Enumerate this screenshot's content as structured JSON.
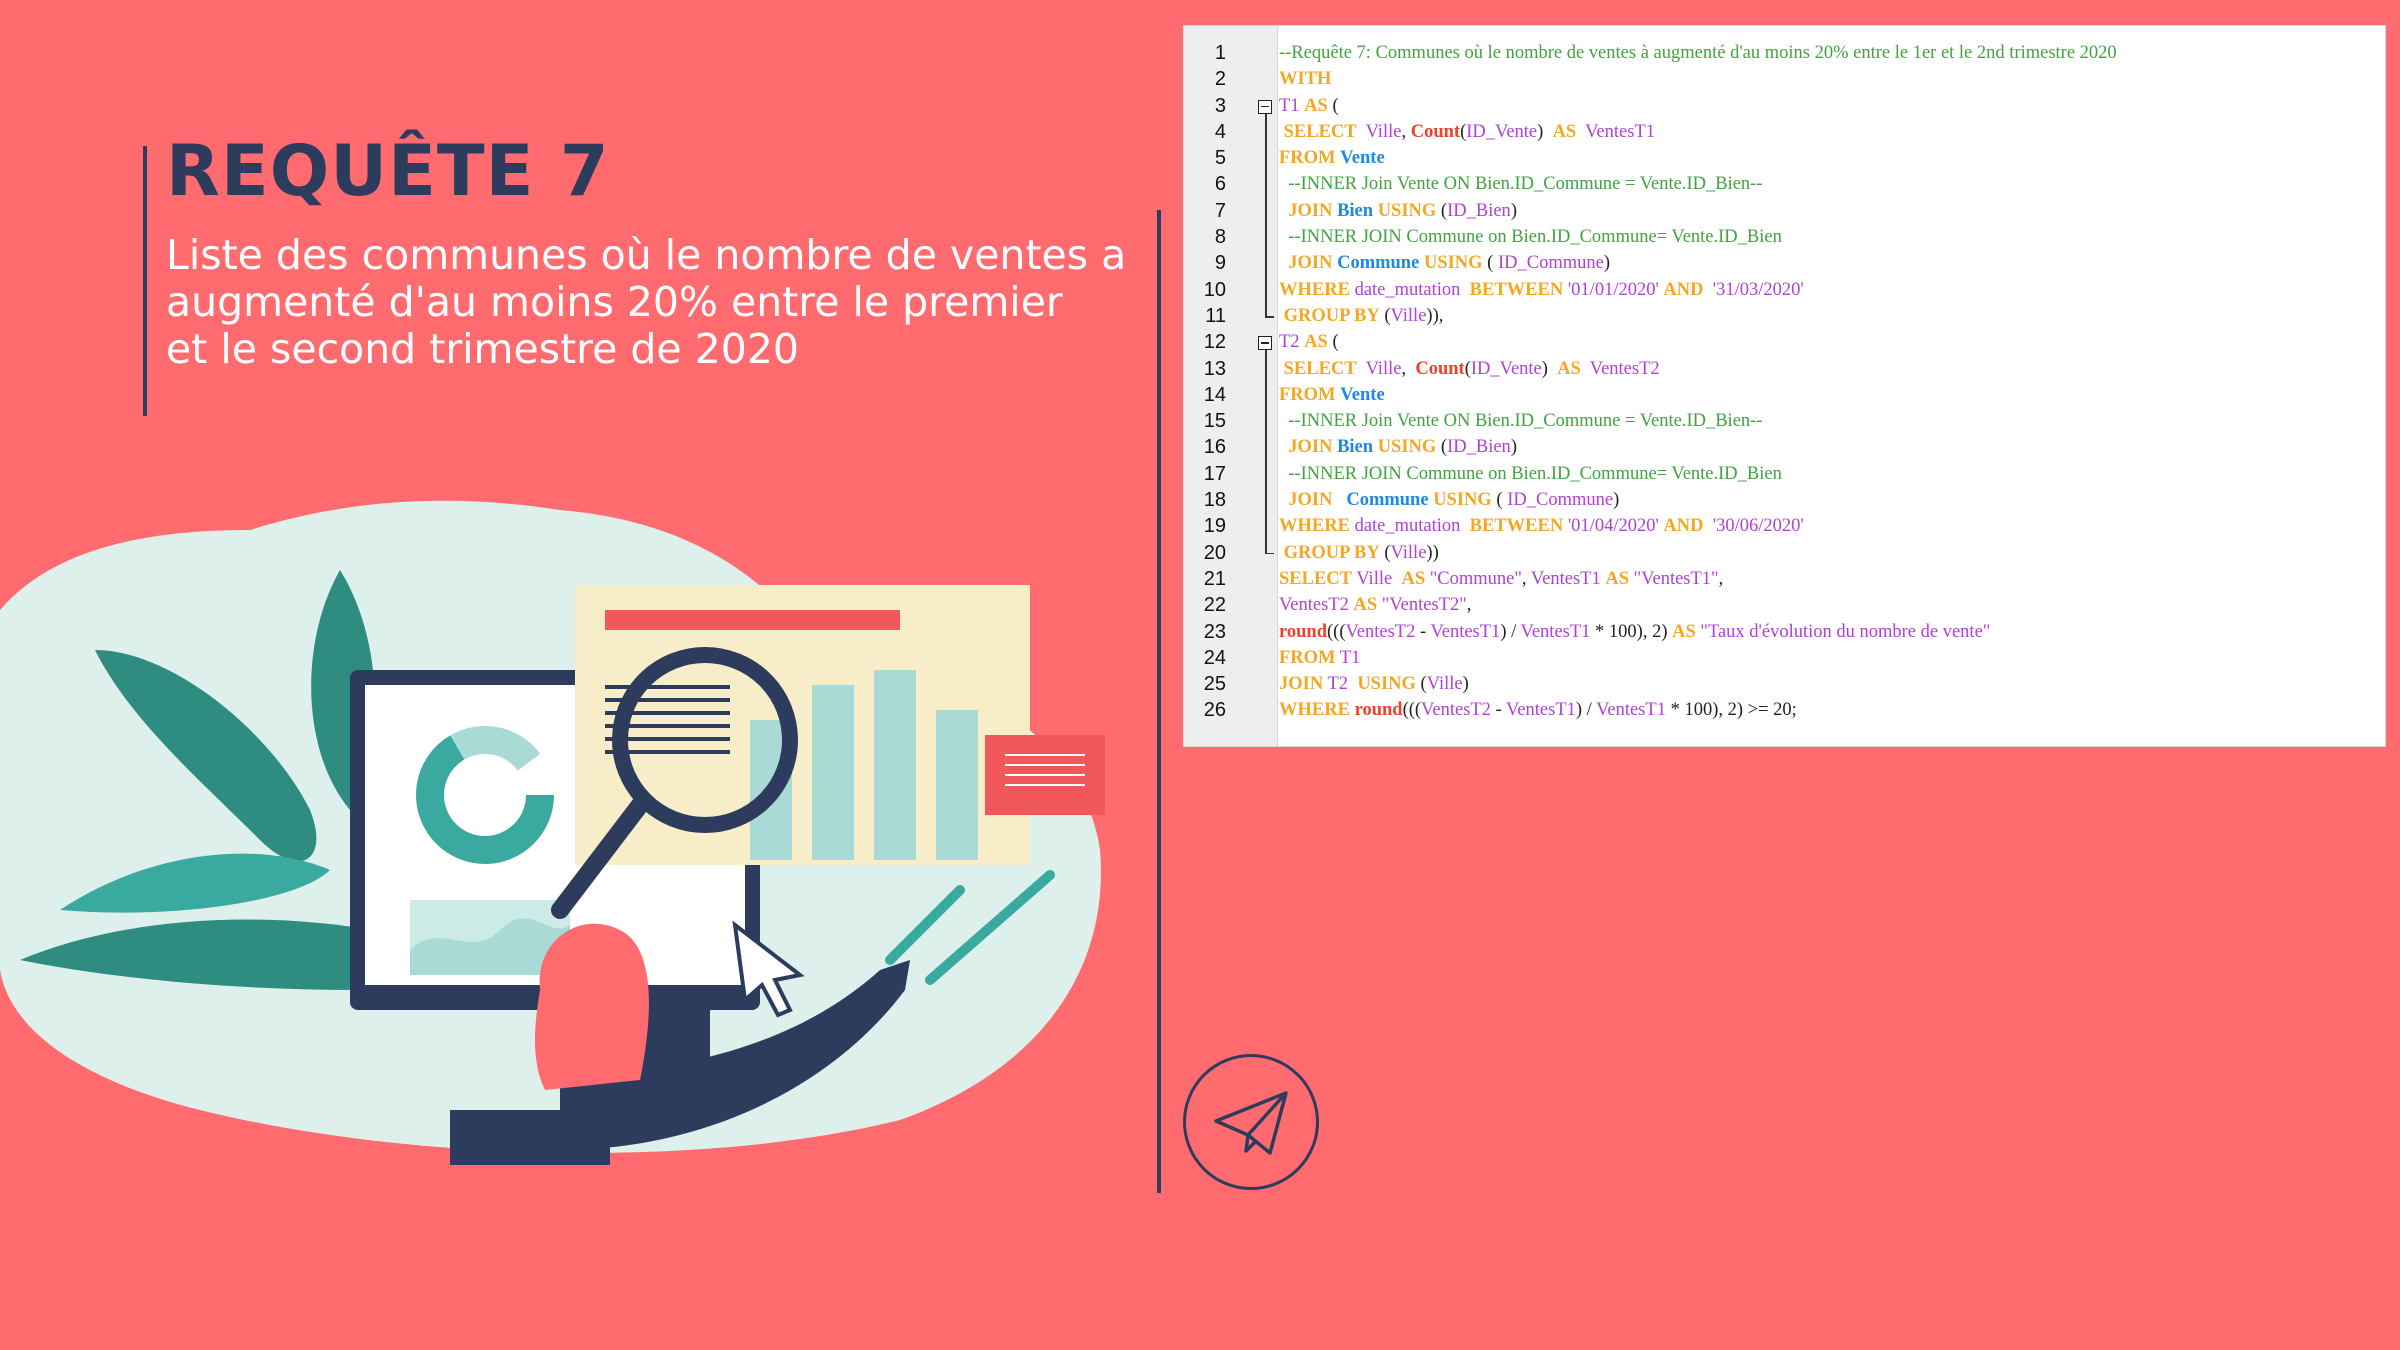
{
  "slide": {
    "title": "REQUÊTE 7",
    "subtitle": "Liste des communes où le nombre de ventes a\naugmenté d'au moins   20% entre le premier\net le second trimestre de 2020"
  },
  "colors": {
    "background": "#FF6B6F",
    "accent_dark": "#2D3C5C",
    "teal": "#3AA99F",
    "cream": "#F8EDC9"
  },
  "icons": {
    "send": "paper-plane-icon",
    "fold": "fold-toggle-icon"
  },
  "code": {
    "lines": [
      {
        "n": "1",
        "tokens": [
          [
            "cmt",
            "--Requête 7: Communes où le nombre de ventes à augmenté d'au moins 20% entre le 1er et le 2nd trimestre 2020"
          ]
        ]
      },
      {
        "n": "2",
        "tokens": [
          [
            "kw",
            "WITH"
          ]
        ]
      },
      {
        "n": "3",
        "tokens": [
          [
            "id",
            "T1"
          ],
          [
            "pl",
            " "
          ],
          [
            "kw",
            "AS"
          ],
          [
            "pl",
            " ("
          ]
        ]
      },
      {
        "n": "4",
        "tokens": [
          [
            "pl",
            " "
          ],
          [
            "kw",
            "SELECT"
          ],
          [
            "pl",
            "  "
          ],
          [
            "id",
            "Ville"
          ],
          [
            "pl",
            ", "
          ],
          [
            "fn",
            "Count"
          ],
          [
            "pl",
            "("
          ],
          [
            "id",
            "ID_Vente"
          ],
          [
            "pl",
            ")  "
          ],
          [
            "kw",
            "AS"
          ],
          [
            "pl",
            "  "
          ],
          [
            "id",
            "VentesT1"
          ]
        ]
      },
      {
        "n": "5",
        "tokens": [
          [
            "kw",
            "FROM"
          ],
          [
            "pl",
            " "
          ],
          [
            "tb",
            "Vente"
          ]
        ]
      },
      {
        "n": "6",
        "tokens": [
          [
            "cmt",
            "  --INNER Join Vente ON Bien.ID_Commune = Vente.ID_Bien--"
          ]
        ]
      },
      {
        "n": "7",
        "tokens": [
          [
            "pl",
            "  "
          ],
          [
            "kw",
            "JOIN"
          ],
          [
            "pl",
            " "
          ],
          [
            "tb",
            "Bien"
          ],
          [
            "pl",
            " "
          ],
          [
            "kw",
            "USING"
          ],
          [
            "pl",
            " ("
          ],
          [
            "id",
            "ID_Bien"
          ],
          [
            "pl",
            ")"
          ]
        ]
      },
      {
        "n": "8",
        "tokens": [
          [
            "cmt",
            "  --INNER JOIN Commune on Bien.ID_Commune= Vente.ID_Bien"
          ]
        ]
      },
      {
        "n": "9",
        "tokens": [
          [
            "pl",
            "  "
          ],
          [
            "kw",
            "JOIN"
          ],
          [
            "pl",
            " "
          ],
          [
            "tb",
            "Commune"
          ],
          [
            "pl",
            " "
          ],
          [
            "kw",
            "USING"
          ],
          [
            "pl",
            " ( "
          ],
          [
            "id",
            "ID_Commune"
          ],
          [
            "pl",
            ")"
          ]
        ]
      },
      {
        "n": "10",
        "tokens": [
          [
            "kw",
            "WHERE"
          ],
          [
            "pl",
            " "
          ],
          [
            "id",
            "date_mutation"
          ],
          [
            "pl",
            "  "
          ],
          [
            "kw",
            "BETWEEN"
          ],
          [
            "pl",
            " "
          ],
          [
            "str",
            "'01/01/2020'"
          ],
          [
            "pl",
            " "
          ],
          [
            "kw",
            "AND"
          ],
          [
            "pl",
            "  "
          ],
          [
            "str",
            "'31/03/2020'"
          ]
        ]
      },
      {
        "n": "11",
        "tokens": [
          [
            "pl",
            " "
          ],
          [
            "kw",
            "GROUP BY"
          ],
          [
            "pl",
            " ("
          ],
          [
            "id",
            "Ville"
          ],
          [
            "pl",
            "))"
          ],
          [
            "pl",
            ","
          ]
        ]
      },
      {
        "n": "12",
        "tokens": [
          [
            "id",
            "T2"
          ],
          [
            "pl",
            " "
          ],
          [
            "kw",
            "AS"
          ],
          [
            "pl",
            " ("
          ]
        ]
      },
      {
        "n": "13",
        "tokens": [
          [
            "pl",
            " "
          ],
          [
            "kw",
            "SELECT"
          ],
          [
            "pl",
            "  "
          ],
          [
            "id",
            "Ville"
          ],
          [
            "pl",
            ",  "
          ],
          [
            "fn",
            "Count"
          ],
          [
            "pl",
            "("
          ],
          [
            "id",
            "ID_Vente"
          ],
          [
            "pl",
            ")  "
          ],
          [
            "kw",
            "AS"
          ],
          [
            "pl",
            "  "
          ],
          [
            "id",
            "VentesT2"
          ]
        ]
      },
      {
        "n": "14",
        "tokens": [
          [
            "kw",
            "FROM"
          ],
          [
            "pl",
            " "
          ],
          [
            "tb",
            "Vente"
          ]
        ]
      },
      {
        "n": "15",
        "tokens": [
          [
            "cmt",
            "  --INNER Join Vente ON Bien.ID_Commune = Vente.ID_Bien--"
          ]
        ]
      },
      {
        "n": "16",
        "tokens": [
          [
            "pl",
            "  "
          ],
          [
            "kw",
            "JOIN"
          ],
          [
            "pl",
            " "
          ],
          [
            "tb",
            "Bien"
          ],
          [
            "pl",
            " "
          ],
          [
            "kw",
            "USING"
          ],
          [
            "pl",
            " ("
          ],
          [
            "id",
            "ID_Bien"
          ],
          [
            "pl",
            ")"
          ]
        ]
      },
      {
        "n": "17",
        "tokens": [
          [
            "cmt",
            "  --INNER JOIN Commune on Bien.ID_Commune= Vente.ID_Bien"
          ]
        ]
      },
      {
        "n": "18",
        "tokens": [
          [
            "pl",
            "  "
          ],
          [
            "kw",
            "JOIN"
          ],
          [
            "pl",
            "   "
          ],
          [
            "tb",
            "Commune"
          ],
          [
            "pl",
            " "
          ],
          [
            "kw",
            "USING"
          ],
          [
            "pl",
            " ( "
          ],
          [
            "id",
            "ID_Commune"
          ],
          [
            "pl",
            ")"
          ]
        ]
      },
      {
        "n": "19",
        "tokens": [
          [
            "kw",
            "WHERE"
          ],
          [
            "pl",
            " "
          ],
          [
            "id",
            "date_mutation"
          ],
          [
            "pl",
            "  "
          ],
          [
            "kw",
            "BETWEEN"
          ],
          [
            "pl",
            " "
          ],
          [
            "str",
            "'01/04/2020'"
          ],
          [
            "pl",
            " "
          ],
          [
            "kw",
            "AND"
          ],
          [
            "pl",
            "  "
          ],
          [
            "str",
            "'30/06/2020'"
          ]
        ]
      },
      {
        "n": "20",
        "tokens": [
          [
            "pl",
            " "
          ],
          [
            "kw",
            "GROUP BY"
          ],
          [
            "pl",
            " ("
          ],
          [
            "id",
            "Ville"
          ],
          [
            "pl",
            "))"
          ]
        ]
      },
      {
        "n": "21",
        "tokens": [
          [
            "kw",
            "SELECT"
          ],
          [
            "pl",
            " "
          ],
          [
            "id",
            "Ville"
          ],
          [
            "pl",
            "  "
          ],
          [
            "kw",
            "AS"
          ],
          [
            "pl",
            " "
          ],
          [
            "str",
            "\"Commune\""
          ],
          [
            "pl",
            ", "
          ],
          [
            "id",
            "VentesT1"
          ],
          [
            "pl",
            " "
          ],
          [
            "kw",
            "AS"
          ],
          [
            "pl",
            " "
          ],
          [
            "str",
            "\"VentesT1\""
          ],
          [
            "pl",
            ","
          ]
        ]
      },
      {
        "n": "22",
        "tokens": [
          [
            "id",
            "VentesT2"
          ],
          [
            "pl",
            " "
          ],
          [
            "kw",
            "AS"
          ],
          [
            "pl",
            " "
          ],
          [
            "str",
            "\"VentesT2\""
          ],
          [
            "pl",
            ","
          ]
        ]
      },
      {
        "n": "23",
        "tokens": [
          [
            "fn",
            "round"
          ],
          [
            "pl",
            "((("
          ],
          [
            "id",
            "VentesT2"
          ],
          [
            "pl",
            " - "
          ],
          [
            "id",
            "VentesT1"
          ],
          [
            "pl",
            ") / "
          ],
          [
            "id",
            "VentesT1"
          ],
          [
            "pl",
            " * 100), 2) "
          ],
          [
            "kw",
            "AS"
          ],
          [
            "pl",
            " "
          ],
          [
            "str",
            "\"Taux d'évolution du nombre de vente\""
          ]
        ]
      },
      {
        "n": "24",
        "tokens": [
          [
            "kw",
            "FROM"
          ],
          [
            "pl",
            " "
          ],
          [
            "id",
            "T1"
          ]
        ]
      },
      {
        "n": "25",
        "tokens": [
          [
            "kw",
            "JOIN"
          ],
          [
            "pl",
            " "
          ],
          [
            "id",
            "T2"
          ],
          [
            "pl",
            "  "
          ],
          [
            "kw",
            "USING"
          ],
          [
            "pl",
            " ("
          ],
          [
            "id",
            "Ville"
          ],
          [
            "pl",
            ")"
          ]
        ]
      },
      {
        "n": "26",
        "tokens": [
          [
            "kw",
            "WHERE"
          ],
          [
            "pl",
            " "
          ],
          [
            "fn",
            "round"
          ],
          [
            "pl",
            "((("
          ],
          [
            "id",
            "VentesT2"
          ],
          [
            "pl",
            " - "
          ],
          [
            "id",
            "VentesT1"
          ],
          [
            "pl",
            ") / "
          ],
          [
            "id",
            "VentesT1"
          ],
          [
            "pl",
            " * 100), 2) >= 20;"
          ]
        ]
      }
    ]
  }
}
